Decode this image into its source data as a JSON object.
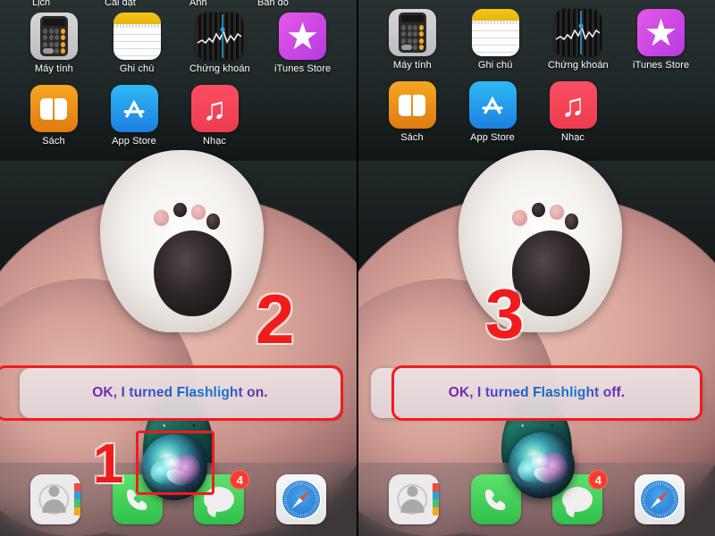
{
  "panels": [
    {
      "id": "left",
      "cut_row_labels": [
        "Lịch",
        "Cài đặt",
        "Ảnh",
        "Bản đồ"
      ],
      "apps_row1": [
        {
          "label": "Máy tính",
          "icon": "calculator-icon"
        },
        {
          "label": "Ghi chú",
          "icon": "notes-icon"
        },
        {
          "label": "Chứng khoán",
          "icon": "stocks-icon"
        },
        {
          "label": "iTunes Store",
          "icon": "itunes-store-icon"
        }
      ],
      "apps_row2": [
        {
          "label": "Sách",
          "icon": "books-icon"
        },
        {
          "label": "App Store",
          "icon": "app-store-icon"
        },
        {
          "label": "Nhạc",
          "icon": "music-icon"
        }
      ],
      "siri_response": "OK, I turned Flashlight on.",
      "dock": [
        {
          "label": "Danh bạ",
          "icon": "contacts-icon",
          "badge": ""
        },
        {
          "label": "Điện thoại",
          "icon": "phone-icon",
          "badge": ""
        },
        {
          "label": "Tin nhắn",
          "icon": "messages-icon",
          "badge": "4"
        },
        {
          "label": "Safari",
          "icon": "safari-icon",
          "badge": ""
        }
      ],
      "annotations": [
        {
          "number": "1",
          "target": "siri-orb"
        },
        {
          "number": "2",
          "target": "siri-response-banner"
        }
      ]
    },
    {
      "id": "right",
      "cut_row_labels": [],
      "apps_row1": [
        {
          "label": "Máy tính",
          "icon": "calculator-icon"
        },
        {
          "label": "Ghi chú",
          "icon": "notes-icon"
        },
        {
          "label": "Chứng khoán",
          "icon": "stocks-icon"
        },
        {
          "label": "iTunes Store",
          "icon": "itunes-store-icon"
        }
      ],
      "apps_row2": [
        {
          "label": "Sách",
          "icon": "books-icon"
        },
        {
          "label": "App Store",
          "icon": "app-store-icon"
        },
        {
          "label": "Nhạc",
          "icon": "music-icon"
        }
      ],
      "siri_response": "OK, I turned Flashlight off.",
      "dock": [
        {
          "label": "Danh bạ",
          "icon": "contacts-icon",
          "badge": ""
        },
        {
          "label": "Điện thoại",
          "icon": "phone-icon",
          "badge": ""
        },
        {
          "label": "Tin nhắn",
          "icon": "messages-icon",
          "badge": "4"
        },
        {
          "label": "Safari",
          "icon": "safari-icon",
          "badge": ""
        }
      ],
      "annotations": [
        {
          "number": "3",
          "target": "siri-response-banner"
        }
      ]
    }
  ],
  "colors": {
    "annotation_red": "#f21b1b",
    "badge_red": "#fc3b30",
    "siri_text_purple": "#7b1fa2",
    "siri_text_blue": "#1565c0"
  }
}
